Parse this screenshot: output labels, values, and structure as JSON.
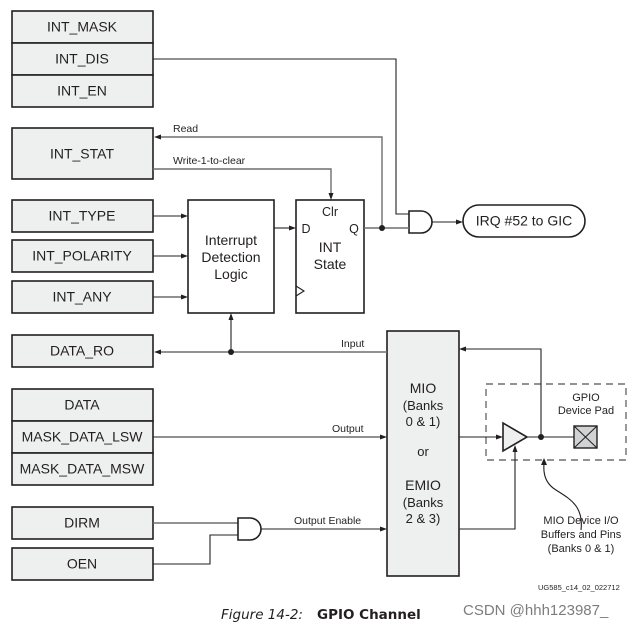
{
  "registers": {
    "int_mask": "INT_MASK",
    "int_dis": "INT_DIS",
    "int_en": "INT_EN",
    "int_stat": "INT_STAT",
    "int_type": "INT_TYPE",
    "int_polarity": "INT_POLARITY",
    "int_any": "INT_ANY",
    "data_ro": "DATA_RO",
    "data": "DATA",
    "mask_data_lsw": "MASK_DATA_LSW",
    "mask_data_msw": "MASK_DATA_MSW",
    "dirm": "DIRM",
    "oen": "OEN"
  },
  "blocks": {
    "detection": [
      "Interrupt",
      "Detection",
      "Logic"
    ],
    "int_state": {
      "clr": "Clr",
      "d": "D",
      "q": "Q",
      "label": [
        "INT",
        "State"
      ]
    },
    "irq": "IRQ #52 to GIC",
    "mio": [
      "MIO",
      "(Banks",
      "0 & 1)",
      "or",
      "EMIO",
      "(Banks",
      "2 & 3)"
    ],
    "pad": [
      "GPIO",
      "Device Pad"
    ],
    "callout": [
      "MIO Device I/O",
      "Buffers and Pins",
      "(Banks 0 & 1)"
    ]
  },
  "signals": {
    "read": "Read",
    "write1clear": "Write-1-to-clear",
    "input": "Input",
    "output": "Output",
    "output_enable": "Output Enable"
  },
  "figure_id": "UG585_c14_02_022712",
  "caption": {
    "number": "Figure 14-2:",
    "title": "GPIO Channel"
  },
  "watermark": "CSDN @hhh123987_"
}
